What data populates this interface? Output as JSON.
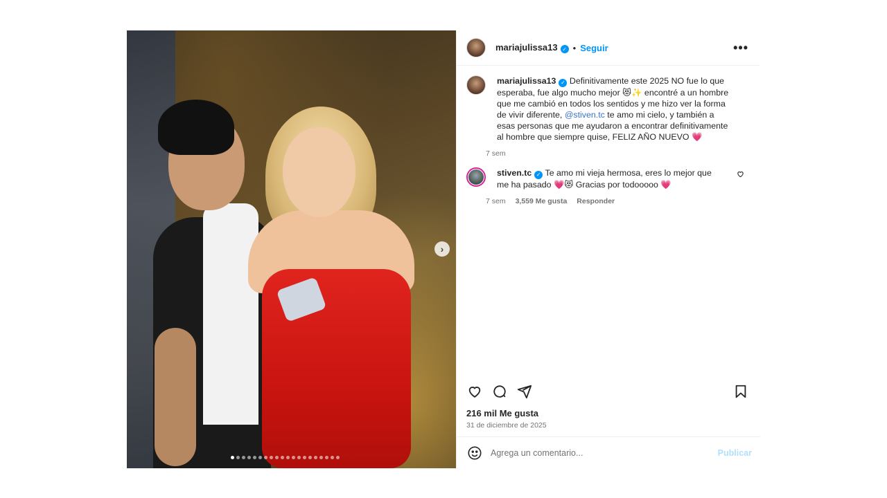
{
  "post": {
    "media": {
      "carousel_dots_total": 20,
      "carousel_dot_active": 1,
      "next_icon": "chevron-right-icon"
    },
    "header": {
      "username": "mariajulissa13",
      "separator": "•",
      "follow_label": "Seguir",
      "more_icon": "more-horizontal-icon",
      "more_label": "•••"
    },
    "caption": {
      "username": "mariajulissa13",
      "text_before_mention": "Definitivamente este 2025 NO fue lo que esperaba, fue algo mucho mejor 😻✨ encontré a un hombre que me cambió en todos los sentidos y me hizo ver la forma de vivir diferente,",
      "mention": "@stiven.tc",
      "text_after_mention": "te amo mi cielo, y también a esas personas que me ayudaron a encontrar definitivamente al hombre que siempre quise, FELIZ AÑO NUEVO 💗",
      "time": "7 sem"
    },
    "comments": [
      {
        "username": "stiven.tc",
        "text": "Te amo mi vieja hermosa, eres lo mejor que me ha pasado 💗😻 Gracias por todooooo 💗",
        "time": "7 sem",
        "likes": "3,559 Me gusta",
        "reply_label": "Responder",
        "heart_icon": "heart-outline-icon"
      }
    ],
    "actions": {
      "like_icon": "heart-outline-icon",
      "comment_icon": "comment-icon",
      "share_icon": "send-icon",
      "save_icon": "bookmark-icon"
    },
    "likes_text": "216 mil Me gusta",
    "date_text": "31 de diciembre de 2025",
    "add_comment": {
      "emoji_icon": "smiley-icon",
      "placeholder": "Agrega un comentario...",
      "publish_label": "Publicar"
    },
    "colors": {
      "link_blue": "#0095f6",
      "publish_disabled": "#b2dffc",
      "mention": "#3772c7",
      "verified": "#0095f6"
    }
  }
}
